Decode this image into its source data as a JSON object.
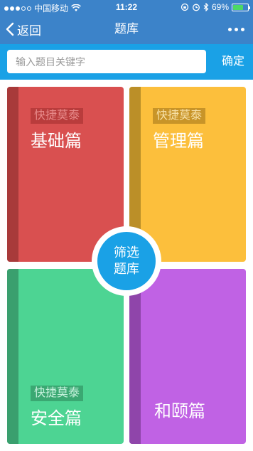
{
  "status_bar": {
    "carrier": "中国移动",
    "time": "11:22",
    "battery_percent_text": "69%",
    "battery_level": 0.69
  },
  "nav": {
    "back_label": "返回",
    "title": "题库"
  },
  "search": {
    "placeholder": "输入题目关键字",
    "confirm_label": "确定"
  },
  "cards": [
    {
      "tag": "快捷莫泰",
      "title": "基础篇",
      "color": "#d95050"
    },
    {
      "tag": "快捷莫泰",
      "title": "管理篇",
      "color": "#fcbf3c"
    },
    {
      "tag": "快捷莫泰",
      "title": "安全篇",
      "color": "#4dd493"
    },
    {
      "title": "和颐篇",
      "color": "#c062e4"
    }
  ],
  "filter_button": {
    "line1": "筛选",
    "line2": "题库",
    "color": "#1aa1e6"
  },
  "colors": {
    "nav_bg": "#3c83c9",
    "search_bg": "#1aa1e6"
  }
}
